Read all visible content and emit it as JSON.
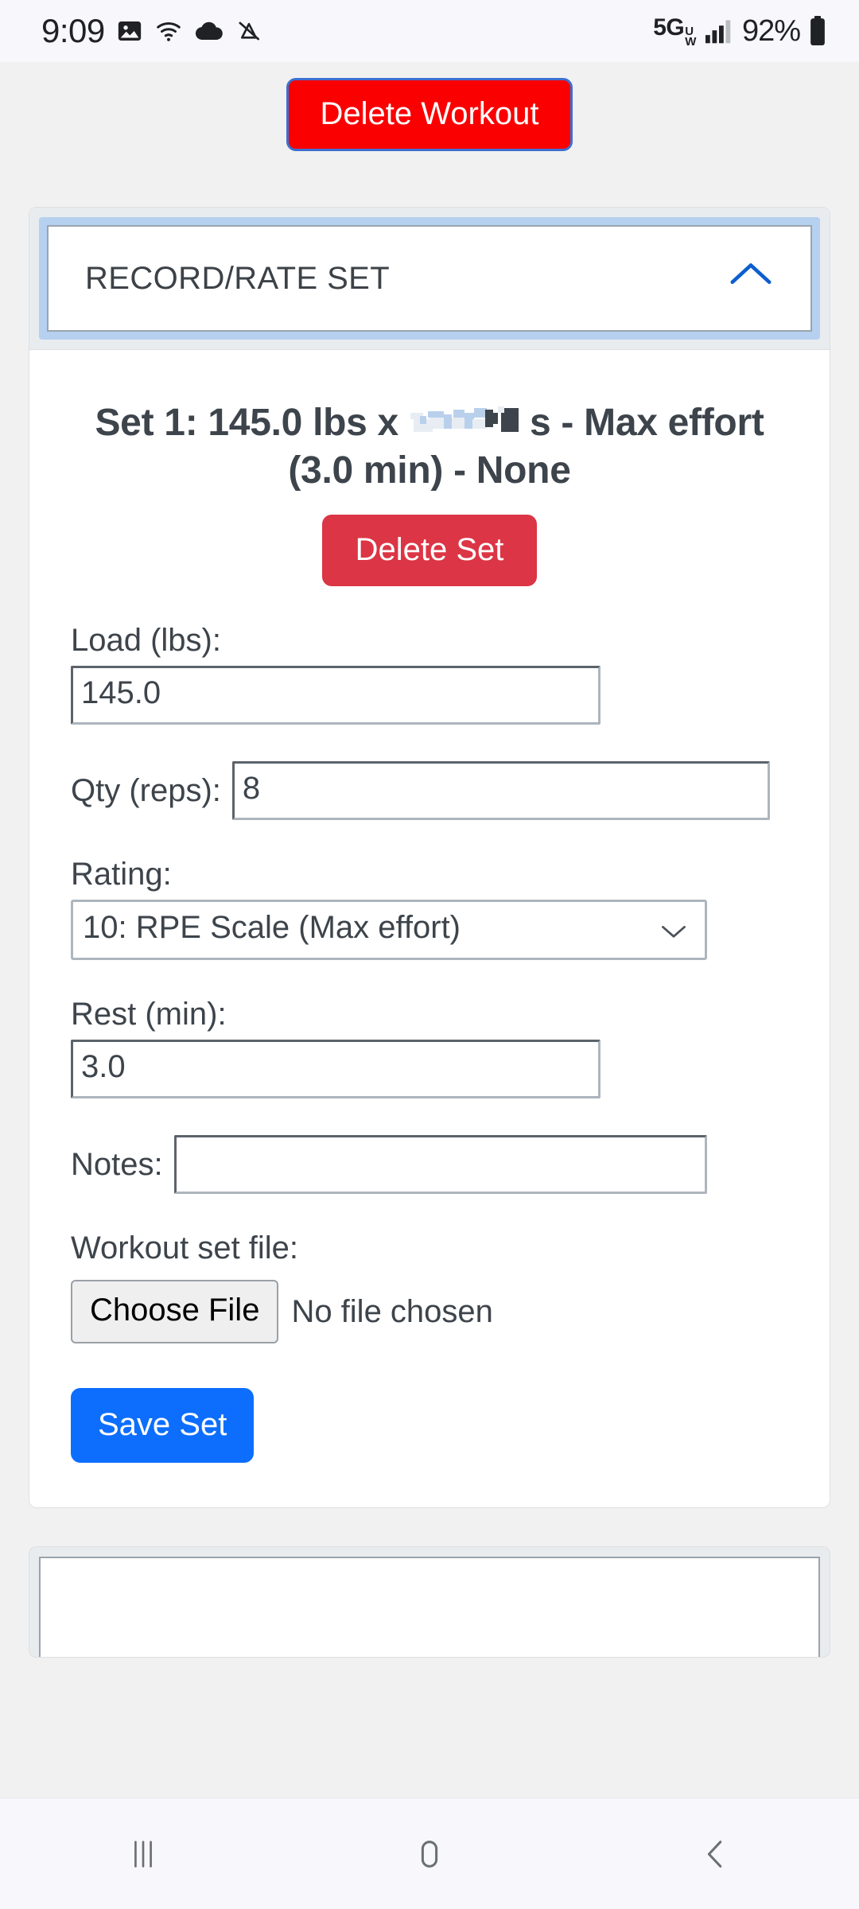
{
  "status_bar": {
    "time": "9:09",
    "left_icons": [
      "image-icon",
      "wifi-icon",
      "cloud-icon",
      "mute-icon"
    ],
    "network_label": "5G",
    "network_sub_top": "U",
    "network_sub_bottom": "W",
    "signal_icon": "signal-bars-icon",
    "battery_percent": "92%",
    "battery_icon": "battery-full-icon"
  },
  "toolbar": {
    "delete_workout_label": "Delete Workout",
    "delete_workout_color": "#fa0000",
    "delete_workout_focus_color": "#3d6fd0"
  },
  "accordion": {
    "title": "RECORD/RATE SET",
    "chevron": "chevron-up-icon",
    "chevron_color": "#0d5ecf",
    "expanded": true,
    "focus_ring_color": "#b6d0ef"
  },
  "set_detail": {
    "title_prefix": "Set 1: 145.0 lbs x ",
    "title_glitch_note": "8 reps",
    "title_suffix": "s - Max effort (3.0 min) - None",
    "delete_set_label": "Delete Set",
    "delete_set_color": "#dc3545"
  },
  "form": {
    "load": {
      "label": "Load (lbs):",
      "value": "145.0",
      "placeholder": ""
    },
    "qty": {
      "label": "Qty (reps):",
      "value": "8",
      "placeholder": ""
    },
    "rating": {
      "label": "Rating:",
      "value": "10: RPE Scale (Max effort)",
      "chevron": "chevron-down-icon"
    },
    "rest": {
      "label": "Rest (min):",
      "value": "3.0",
      "placeholder": ""
    },
    "notes": {
      "label": "Notes:",
      "value": "",
      "placeholder": ""
    },
    "file": {
      "label": "Workout set file:",
      "button_label": "Choose File",
      "status": "No file chosen"
    },
    "save_label": "Save Set",
    "save_color": "#0d6efd"
  },
  "next_card": {
    "title": ""
  },
  "nav_bar": {
    "recents": "recents-icon",
    "home": "home-icon",
    "back": "back-icon"
  }
}
